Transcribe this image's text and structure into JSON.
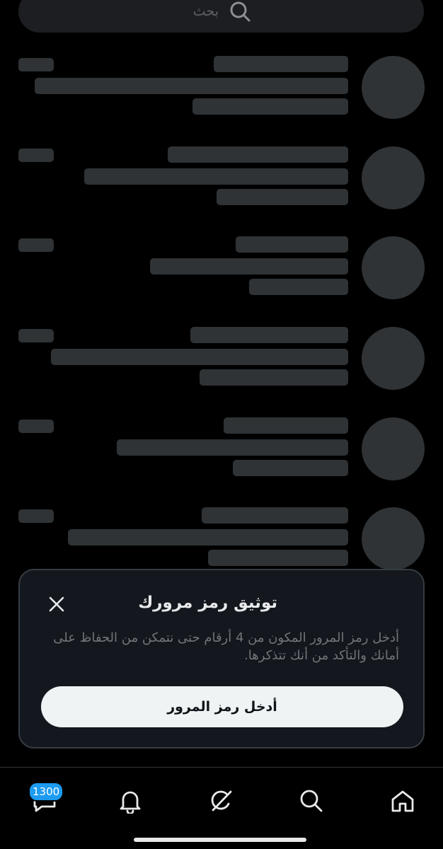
{
  "search": {
    "placeholder": "بحث",
    "icon": "search-icon"
  },
  "skeleton_rows": 6,
  "passcode_prompt": {
    "title": "توثيق رمز مرورك",
    "body": "أدخل رمز المرور المكون من 4 أرقام حتى نتمكن من الحفاظ على أمانك والتأكد من أنك تتذكرها.",
    "button_label": "أدخل رمز المرور",
    "close_icon": "close-icon"
  },
  "bottom_nav": {
    "items": [
      {
        "name": "home",
        "icon": "home-icon"
      },
      {
        "name": "search",
        "icon": "search-icon"
      },
      {
        "name": "grok",
        "icon": "grok-icon"
      },
      {
        "name": "notifications",
        "icon": "bell-icon"
      },
      {
        "name": "messages",
        "icon": "messages-icon"
      }
    ],
    "messages_badge": "1300"
  },
  "colors": {
    "background": "#000000",
    "skeleton": "#2f3336",
    "sheet": "#14181e",
    "accent": "#1d9bf0"
  }
}
